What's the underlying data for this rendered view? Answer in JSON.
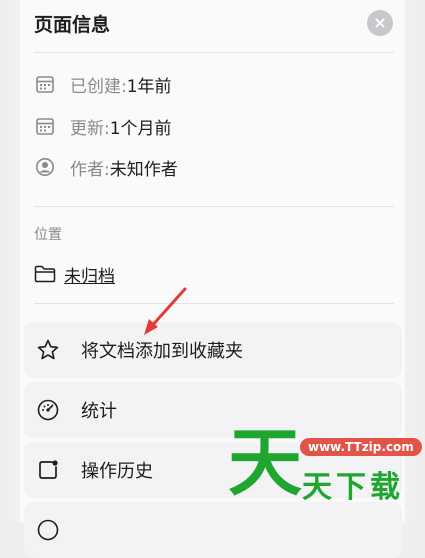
{
  "header": {
    "title": "页面信息",
    "close_glyph": "×"
  },
  "meta": [
    {
      "icon": "calendar-icon",
      "label": "已创建: ",
      "value": "1年前"
    },
    {
      "icon": "calendar-icon",
      "label": "更新: ",
      "value": "1个月前"
    },
    {
      "icon": "person-icon",
      "label": "作者: ",
      "value": "未知作者"
    }
  ],
  "location": {
    "caption": "位置",
    "icon": "folder-icon",
    "value": "未归档"
  },
  "actions": [
    {
      "icon": "star-icon",
      "label": "将文档添加到收藏夹"
    },
    {
      "icon": "gauge-icon",
      "label": "统计"
    },
    {
      "icon": "history-icon",
      "label": "操作历史"
    }
  ],
  "watermark": {
    "url": "www.TTzip.com",
    "big_char": "天",
    "small_text": "天下载"
  },
  "colors": {
    "accent_arrow": "#e53935",
    "watermark_green": "#1fa62f",
    "watermark_red": "#e2534a"
  }
}
